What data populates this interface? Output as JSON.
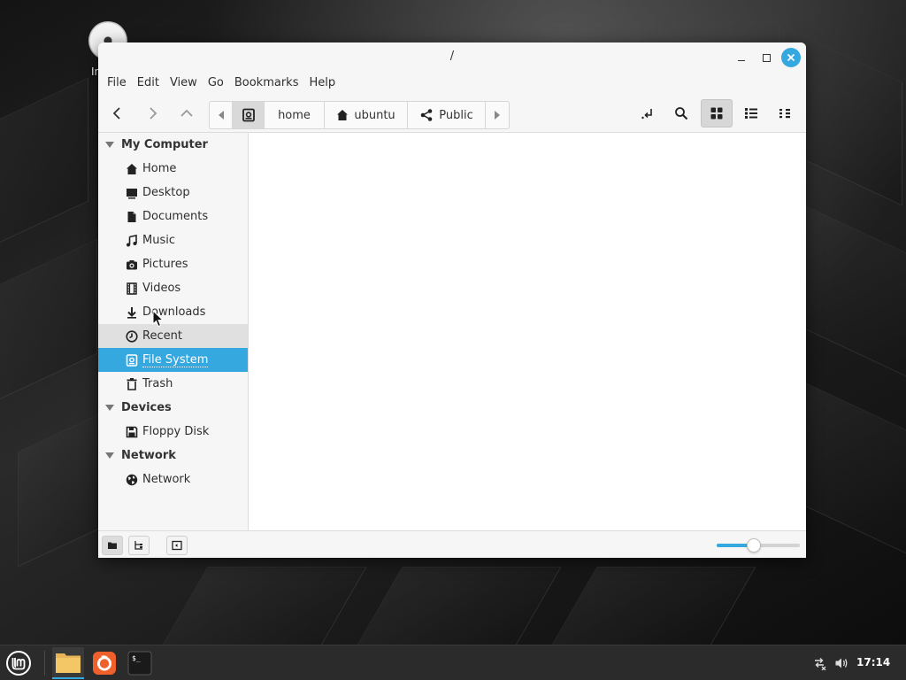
{
  "desktop": {
    "icon_label": "In"
  },
  "window": {
    "title": "/",
    "controls": {
      "minimize": "minimize-icon",
      "maximize": "maximize-icon",
      "close": "close-icon"
    }
  },
  "menubar": {
    "items": [
      "File",
      "Edit",
      "View",
      "Go",
      "Bookmarks",
      "Help"
    ]
  },
  "toolbar": {
    "back_icon": "chevron-left-icon",
    "forward_icon": "chevron-right-icon",
    "up_icon": "chevron-up-icon",
    "pathbar": {
      "left_arrow": "triangle-left-icon",
      "root_icon": "drive-icon",
      "segments": [
        "home",
        "ubuntu",
        "Public"
      ],
      "right_arrow": "triangle-right-icon"
    },
    "right_icons": [
      "location-toggle-icon",
      "search-icon",
      "icon-view-icon",
      "list-view-icon",
      "compact-view-icon"
    ]
  },
  "sidebar": {
    "sections": [
      {
        "title": "My Computer",
        "items": [
          {
            "label": "Home",
            "icon": "home-icon"
          },
          {
            "label": "Desktop",
            "icon": "desktop-icon"
          },
          {
            "label": "Documents",
            "icon": "document-icon"
          },
          {
            "label": "Music",
            "icon": "music-icon"
          },
          {
            "label": "Pictures",
            "icon": "camera-icon"
          },
          {
            "label": "Videos",
            "icon": "film-icon"
          },
          {
            "label": "Downloads",
            "icon": "download-icon"
          },
          {
            "label": "Recent",
            "icon": "clock-icon"
          },
          {
            "label": "File System",
            "icon": "drive-icon"
          },
          {
            "label": "Trash",
            "icon": "trash-icon"
          }
        ]
      },
      {
        "title": "Devices",
        "items": [
          {
            "label": "Floppy Disk",
            "icon": "floppy-icon"
          }
        ]
      },
      {
        "title": "Network",
        "items": [
          {
            "label": "Network",
            "icon": "globe-icon"
          }
        ]
      }
    ],
    "selected": "File System",
    "hovered": "Recent"
  },
  "statusbar": {
    "zoom_level": 0.45
  },
  "taskbar": {
    "clock": "17:14",
    "apps": [
      "files-icon",
      "firefox-icon",
      "terminal-icon"
    ]
  },
  "colors": {
    "accent": "#35a8e0",
    "window_bg": "#f6f6f6",
    "taskbar_bg": "#2b2b2b"
  }
}
